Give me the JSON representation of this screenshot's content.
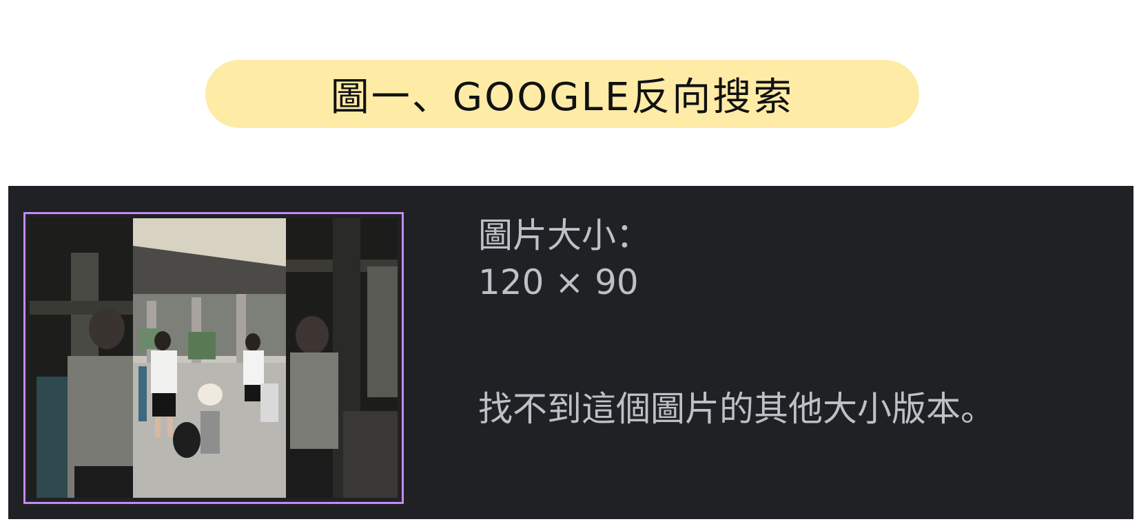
{
  "title": "圖一、GOOGLE反向搜索",
  "result": {
    "size_label": "圖片大小：",
    "size_value": "120 × 90",
    "no_other_sizes": "找不到這個圖片的其他大小版本。"
  },
  "colors": {
    "title_background": "#fdeba6",
    "panel_background": "#202124",
    "thumbnail_border": "#c58af9",
    "text": "#bdc1c6"
  }
}
